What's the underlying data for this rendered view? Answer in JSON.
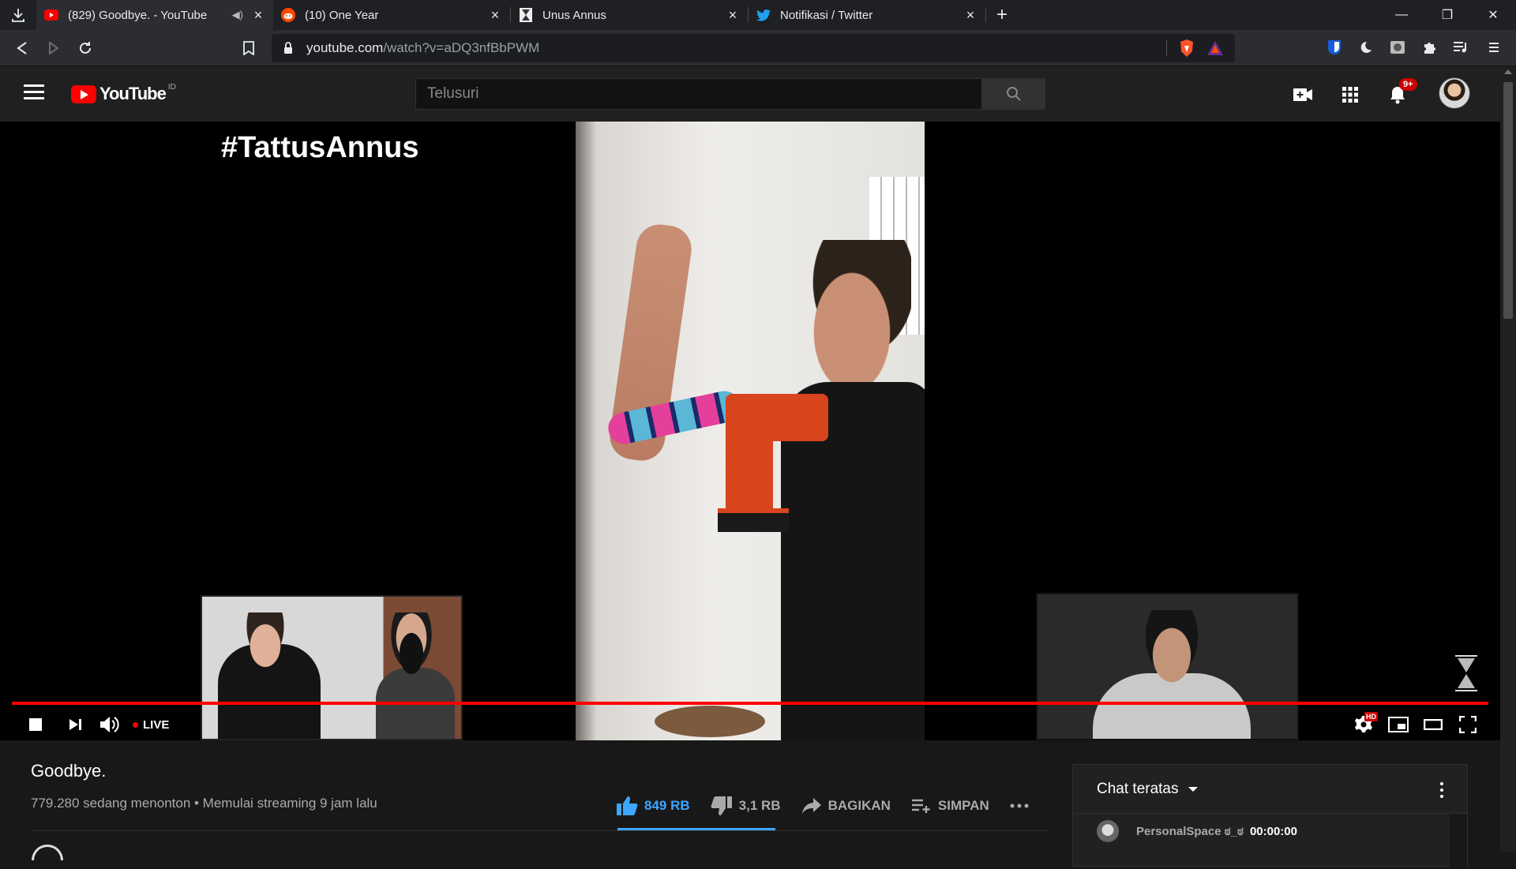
{
  "browser": {
    "tabs": [
      {
        "title": "(829) Goodbye. - YouTube",
        "icon": "youtube-icon",
        "active": true,
        "muted_icon": "speaker-icon"
      },
      {
        "title": "(10) One Year",
        "icon": "reddit-icon",
        "active": false
      },
      {
        "title": "Unus Annus",
        "icon": "hourglass-icon",
        "active": false
      },
      {
        "title": "Notifikasi / Twitter",
        "icon": "twitter-icon",
        "active": false
      }
    ],
    "url_host": "youtube.com",
    "url_path": "/watch?v=aDQ3nfBbPWM"
  },
  "youtube": {
    "region": "ID",
    "search_placeholder": "Telusuri",
    "notification_count": "9+"
  },
  "player": {
    "overlay_hashtag": "#TattusAnnus",
    "live_label": "LIVE",
    "hd_badge": "HD"
  },
  "video": {
    "title": "Goodbye.",
    "meta": "779.280 sedang menonton • Memulai streaming 9 jam lalu",
    "likes": "849 RB",
    "dislikes": "3,1 RB",
    "share_label": "BAGIKAN",
    "save_label": "SIMPAN"
  },
  "chat": {
    "header": "Chat teratas",
    "messages": [
      {
        "author": "PersonalSpace ಠ_ಠ",
        "text": "00:00:00"
      }
    ]
  },
  "colors": {
    "accent_red": "#ff0000",
    "like_blue": "#3ea6ff",
    "bg": "#181818"
  }
}
